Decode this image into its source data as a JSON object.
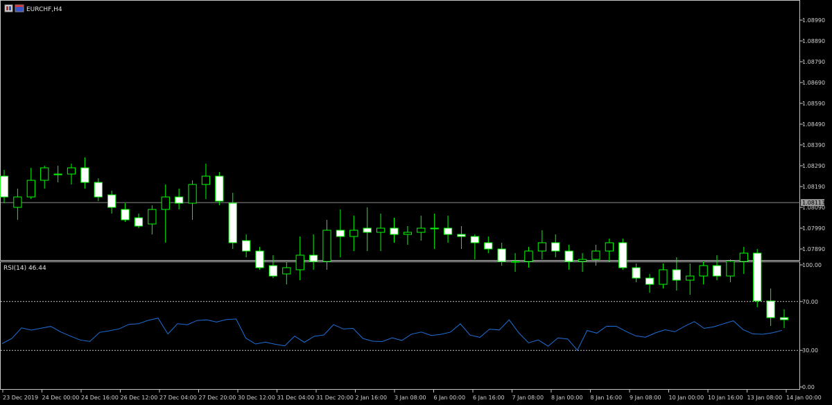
{
  "chart_data": [
    {
      "type": "candlestick",
      "title": "EURCHF,H4",
      "ylim": [
        1.0784,
        1.0908
      ],
      "y_ticks": [
        "1.08990",
        "1.08890",
        "1.08790",
        "1.08690",
        "1.08590",
        "1.08490",
        "1.08390",
        "1.08290",
        "1.08190",
        "1.08090",
        "1.07990",
        "1.07890"
      ],
      "current_price": "1.08113",
      "colors": {
        "bull": "#00ff00",
        "bear_fill": "#ffffff",
        "bear_outline": "#00ff00",
        "wick": "#00ff00",
        "grid": "none",
        "price_line": "#8c8c8c"
      },
      "candles": [
        {
          "o": 1.0824,
          "h": 1.0827,
          "l": 1.0811,
          "c": 1.0814
        },
        {
          "o": 1.0809,
          "h": 1.0818,
          "l": 1.0803,
          "c": 1.0814
        },
        {
          "o": 1.0814,
          "h": 1.0828,
          "l": 1.0813,
          "c": 1.0822
        },
        {
          "o": 1.0822,
          "h": 1.0829,
          "l": 1.0818,
          "c": 1.0828
        },
        {
          "o": 1.0825,
          "h": 1.0829,
          "l": 1.0821,
          "c": 1.0825
        },
        {
          "o": 1.0825,
          "h": 1.083,
          "l": 1.082,
          "c": 1.0828
        },
        {
          "o": 1.0828,
          "h": 1.0833,
          "l": 1.0818,
          "c": 1.0821
        },
        {
          "o": 1.0821,
          "h": 1.0823,
          "l": 1.0812,
          "c": 1.0814
        },
        {
          "o": 1.0815,
          "h": 1.0817,
          "l": 1.0806,
          "c": 1.0809
        },
        {
          "o": 1.0808,
          "h": 1.0811,
          "l": 1.0802,
          "c": 1.0803
        },
        {
          "o": 1.0804,
          "h": 1.0806,
          "l": 1.0799,
          "c": 1.08
        },
        {
          "o": 1.0801,
          "h": 1.081,
          "l": 1.0796,
          "c": 1.0808
        },
        {
          "o": 1.0808,
          "h": 1.082,
          "l": 1.0792,
          "c": 1.0814
        },
        {
          "o": 1.0814,
          "h": 1.0818,
          "l": 1.0808,
          "c": 1.0811
        },
        {
          "o": 1.0811,
          "h": 1.0822,
          "l": 1.0803,
          "c": 1.082
        },
        {
          "o": 1.082,
          "h": 1.083,
          "l": 1.0813,
          "c": 1.0824
        },
        {
          "o": 1.0824,
          "h": 1.0826,
          "l": 1.081,
          "c": 1.0812
        },
        {
          "o": 1.0811,
          "h": 1.0816,
          "l": 1.0789,
          "c": 1.0792
        },
        {
          "o": 1.0793,
          "h": 1.0796,
          "l": 1.0785,
          "c": 1.0788
        },
        {
          "o": 1.0788,
          "h": 1.079,
          "l": 1.0779,
          "c": 1.078
        },
        {
          "o": 1.0781,
          "h": 1.0786,
          "l": 1.0775,
          "c": 1.0776
        },
        {
          "o": 1.0777,
          "h": 1.0783,
          "l": 1.0772,
          "c": 1.078
        },
        {
          "o": 1.0779,
          "h": 1.0795,
          "l": 1.0774,
          "c": 1.0786
        },
        {
          "o": 1.0786,
          "h": 1.0796,
          "l": 1.0779,
          "c": 1.0783
        },
        {
          "o": 1.0783,
          "h": 1.0803,
          "l": 1.0779,
          "c": 1.0798
        },
        {
          "o": 1.0798,
          "h": 1.0808,
          "l": 1.0785,
          "c": 1.0795
        },
        {
          "o": 1.0795,
          "h": 1.0805,
          "l": 1.0788,
          "c": 1.0798
        },
        {
          "o": 1.0799,
          "h": 1.0809,
          "l": 1.0788,
          "c": 1.0797
        },
        {
          "o": 1.0797,
          "h": 1.0806,
          "l": 1.0788,
          "c": 1.0799
        },
        {
          "o": 1.0799,
          "h": 1.0804,
          "l": 1.0792,
          "c": 1.0796
        },
        {
          "o": 1.0796,
          "h": 1.08,
          "l": 1.0791,
          "c": 1.0797
        },
        {
          "o": 1.0797,
          "h": 1.0805,
          "l": 1.0793,
          "c": 1.0799
        },
        {
          "o": 1.0799,
          "h": 1.0806,
          "l": 1.0789,
          "c": 1.0799
        },
        {
          "o": 1.0799,
          "h": 1.0805,
          "l": 1.0792,
          "c": 1.0796
        },
        {
          "o": 1.0796,
          "h": 1.08,
          "l": 1.0789,
          "c": 1.0795
        },
        {
          "o": 1.0795,
          "h": 1.0796,
          "l": 1.0784,
          "c": 1.0792
        },
        {
          "o": 1.0792,
          "h": 1.0795,
          "l": 1.0787,
          "c": 1.0789
        },
        {
          "o": 1.0789,
          "h": 1.0792,
          "l": 1.0781,
          "c": 1.0783
        },
        {
          "o": 1.0783,
          "h": 1.0787,
          "l": 1.0778,
          "c": 1.0783
        },
        {
          "o": 1.0783,
          "h": 1.079,
          "l": 1.078,
          "c": 1.0788
        },
        {
          "o": 1.0788,
          "h": 1.0798,
          "l": 1.0784,
          "c": 1.0792
        },
        {
          "o": 1.0792,
          "h": 1.0796,
          "l": 1.0785,
          "c": 1.0788
        },
        {
          "o": 1.0788,
          "h": 1.0791,
          "l": 1.0779,
          "c": 1.0783
        },
        {
          "o": 1.0783,
          "h": 1.0787,
          "l": 1.0778,
          "c": 1.0784
        },
        {
          "o": 1.0784,
          "h": 1.0791,
          "l": 1.0781,
          "c": 1.0788
        },
        {
          "o": 1.0788,
          "h": 1.0794,
          "l": 1.0783,
          "c": 1.0792
        },
        {
          "o": 1.0792,
          "h": 1.0794,
          "l": 1.0779,
          "c": 1.078
        },
        {
          "o": 1.078,
          "h": 1.0782,
          "l": 1.0773,
          "c": 1.0775
        },
        {
          "o": 1.0775,
          "h": 1.0777,
          "l": 1.0768,
          "c": 1.0772
        },
        {
          "o": 1.0772,
          "h": 1.0782,
          "l": 1.077,
          "c": 1.0779
        },
        {
          "o": 1.0779,
          "h": 1.0785,
          "l": 1.0769,
          "c": 1.0774
        },
        {
          "o": 1.0774,
          "h": 1.0782,
          "l": 1.0767,
          "c": 1.0776
        },
        {
          "o": 1.0776,
          "h": 1.0783,
          "l": 1.0772,
          "c": 1.0781
        },
        {
          "o": 1.0781,
          "h": 1.0786,
          "l": 1.0774,
          "c": 1.0776
        },
        {
          "o": 1.0776,
          "h": 1.0784,
          "l": 1.0773,
          "c": 1.0783
        },
        {
          "o": 1.0783,
          "h": 1.079,
          "l": 1.0777,
          "c": 1.0787
        },
        {
          "o": 1.0787,
          "h": 1.0789,
          "l": 1.0761,
          "c": 1.0764
        },
        {
          "o": 1.0764,
          "h": 1.077,
          "l": 1.0752,
          "c": 1.0756
        },
        {
          "o": 1.0756,
          "h": 1.076,
          "l": 1.0751,
          "c": 1.0755
        }
      ]
    },
    {
      "type": "line",
      "title": "RSI(14) 46.44",
      "ylim": [
        0,
        100
      ],
      "y_ticks": [
        "100.00",
        "70.00",
        "30.00",
        "0.00"
      ],
      "levels": [
        70,
        30
      ],
      "x": [
        "23 Dec 2019",
        "24 Dec 00:00",
        "24 Dec 16:00",
        "26 Dec 12:00",
        "27 Dec 04:00",
        "27 Dec 20:00",
        "30 Dec 12:00",
        "31 Dec 04:00",
        "31 Dec 20:00",
        "2 Jan 16:00",
        "3 Jan 08:00",
        "6 Jan 00:00",
        "6 Jan 16:00",
        "7 Jan 08:00",
        "8 Jan 00:00",
        "8 Jan 16:00",
        "9 Jan 08:00",
        "10 Jan 00:00",
        "10 Jan 16:00",
        "13 Jan 08:00",
        "14 Jan 00:00"
      ],
      "series": [
        {
          "color": "#1e6fd9",
          "values": [
            35.5,
            39.8,
            48.4,
            46.6,
            48.1,
            49.6,
            45.1,
            41.7,
            38.5,
            37.3,
            44.7,
            46.0,
            47.6,
            51.3,
            51.8,
            54.6,
            56.4,
            43.4,
            51.8,
            51.0,
            54.5,
            55.0,
            53.2,
            55.2,
            55.7,
            40.0,
            35.2,
            36.7,
            35.0,
            33.7,
            41.7,
            36.6,
            41.5,
            42.6,
            51.1,
            47.5,
            48.0,
            39.8,
            37.5,
            37.2,
            40.2,
            38.1,
            43.3,
            45.0,
            42.2,
            43.1,
            45.0,
            51.7,
            42.5,
            40.7,
            47.4,
            46.7,
            55.0,
            44.3,
            36.2,
            38.5,
            33.4,
            40.1,
            39.4,
            30.1,
            46.3,
            44.1,
            49.8,
            49.7,
            45.5,
            41.8,
            40.8,
            44.3,
            46.9,
            45.2,
            49.8,
            53.6,
            48.0,
            49.3,
            51.8,
            54.2,
            47.0,
            43.5,
            43.2,
            44.4,
            46.4
          ]
        }
      ]
    }
  ],
  "x_axis_labels": [
    "23 Dec 2019",
    "24 Dec 00:00",
    "24 Dec 16:00",
    "26 Dec 12:00",
    "27 Dec 04:00",
    "27 Dec 20:00",
    "30 Dec 12:00",
    "31 Dec 04:00",
    "31 Dec 20:00",
    "2 Jan 16:00",
    "3 Jan 08:00",
    "6 Jan 00:00",
    "6 Jan 16:00",
    "7 Jan 08:00",
    "8 Jan 00:00",
    "8 Jan 16:00",
    "9 Jan 08:00",
    "10 Jan 00:00",
    "10 Jan 16:00",
    "13 Jan 08:00",
    "14 Jan 00:00"
  ],
  "icons": {
    "chart-window-icon": "chart-window-icon",
    "flag-icon": "flag-icon"
  }
}
